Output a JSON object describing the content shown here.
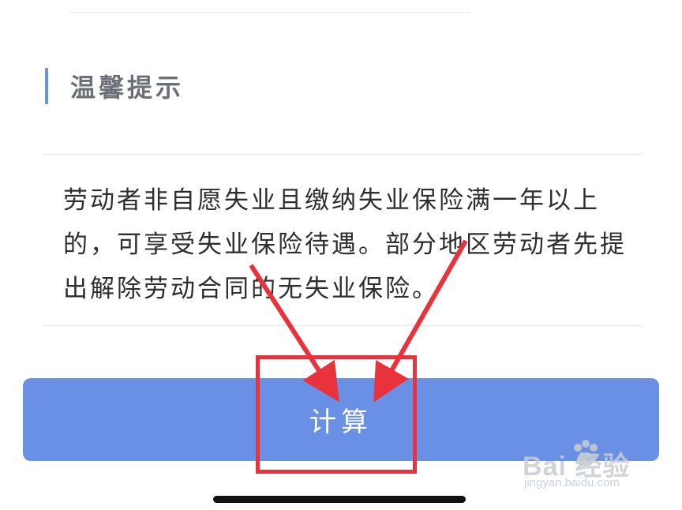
{
  "section": {
    "title": "温馨提示"
  },
  "tip": {
    "text": "劳动者非自愿失业且缴纳失业保险满一年以上的，可享受失业保险待遇。部分地区劳动者先提出解除劳动合同的无失业保险。"
  },
  "actions": {
    "calculate_label": "计算"
  },
  "watermark": {
    "logo_text": "Bai  经验",
    "url": "jingyan.baidu.com"
  },
  "colors": {
    "accent": "#6b93e0",
    "button": "#6990e5",
    "annotation": "#e8323c"
  },
  "icons": {
    "watermark": "baidu-paw-icon"
  }
}
